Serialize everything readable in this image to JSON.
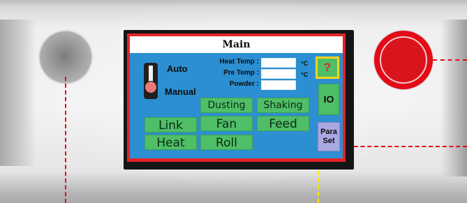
{
  "screen": {
    "title": "Main",
    "mode_auto": "Auto",
    "mode_manual": "Manual",
    "fields": [
      {
        "label": "Heat Temp :",
        "value": "",
        "unit": "°C"
      },
      {
        "label": "Pre Temp :",
        "value": "",
        "unit": "°C"
      },
      {
        "label": "Powder :",
        "value": "",
        "unit": ""
      }
    ],
    "buttons": {
      "dusting": "Dusting",
      "shaking": "Shaking",
      "link": "Link",
      "fan": "Fan",
      "feed": "Feed",
      "heat": "Heat",
      "roll": "Roll"
    },
    "side": {
      "help": "?",
      "io": "IO",
      "para_set_line1": "Para",
      "para_set_line2": "Set"
    }
  },
  "colors": {
    "screen_border": "#e42427",
    "screen_bg": "#2b8fd1",
    "button_green": "#4fbe67",
    "help_yellow": "#ffd21a",
    "para_purple": "#a9a8e2",
    "estop_red": "#e30b18",
    "callout_red": "#e30b18",
    "callout_yellow": "#ffe600"
  },
  "icons": {
    "help": "question-mark-icon",
    "toggle": "auto-manual-toggle-switch",
    "knob": "selector-knob",
    "estop": "emergency-stop-button"
  }
}
